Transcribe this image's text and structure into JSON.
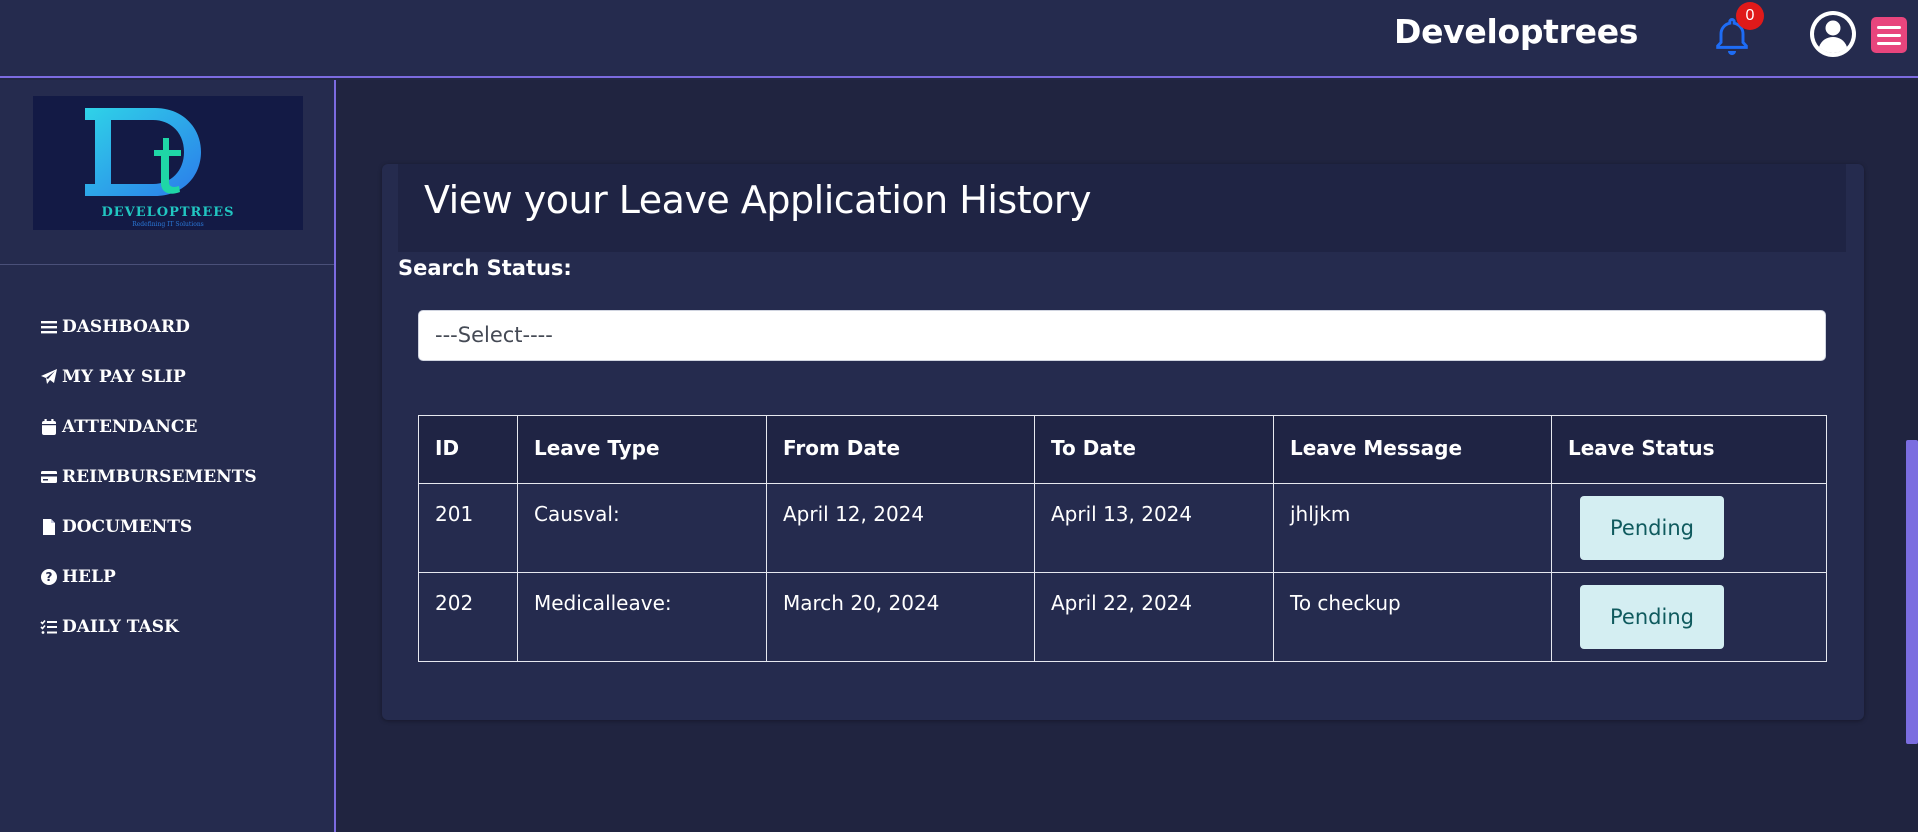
{
  "header": {
    "brand": "Developtrees",
    "notification_count": "0"
  },
  "sidebar": {
    "logo_text": "DEVELOPTREES",
    "logo_tagline": "Redefining IT Solutions",
    "items": [
      {
        "label": "DASHBOARD",
        "icon": "bars-icon"
      },
      {
        "label": "MY PAY SLIP",
        "icon": "paper-plane-icon"
      },
      {
        "label": "ATTENDANCE",
        "icon": "calendar-icon"
      },
      {
        "label": "REIMBURSEMENTS",
        "icon": "credit-card-icon"
      },
      {
        "label": "DOCUMENTS",
        "icon": "file-icon"
      },
      {
        "label": "HELP",
        "icon": "question-circle-icon"
      },
      {
        "label": "DAILY TASK",
        "icon": "list-check-icon"
      }
    ]
  },
  "main": {
    "title": "View your Leave Application History",
    "search_label": "Search Status:",
    "select_value": "---Select----"
  },
  "table": {
    "headers": [
      "ID",
      "Leave Type",
      "From Date",
      "To Date",
      "Leave Message",
      "Leave Status"
    ],
    "rows": [
      {
        "id": "201",
        "type": "Causval:",
        "from": "April 12, 2024",
        "to": "April 13, 2024",
        "message": "jhljkm",
        "status": "Pending"
      },
      {
        "id": "202",
        "type": "Medicalleave:",
        "from": "March 20, 2024",
        "to": "April 22, 2024",
        "message": "To checkup",
        "status": "Pending"
      }
    ]
  },
  "colors": {
    "background": "#222745",
    "panel": "#252b4e",
    "accent": "#7c6be0",
    "menu_button": "#e8457d",
    "bell": "#1e6cf5",
    "badge": "#e01a1a",
    "status_pill": "#d4eef2"
  }
}
